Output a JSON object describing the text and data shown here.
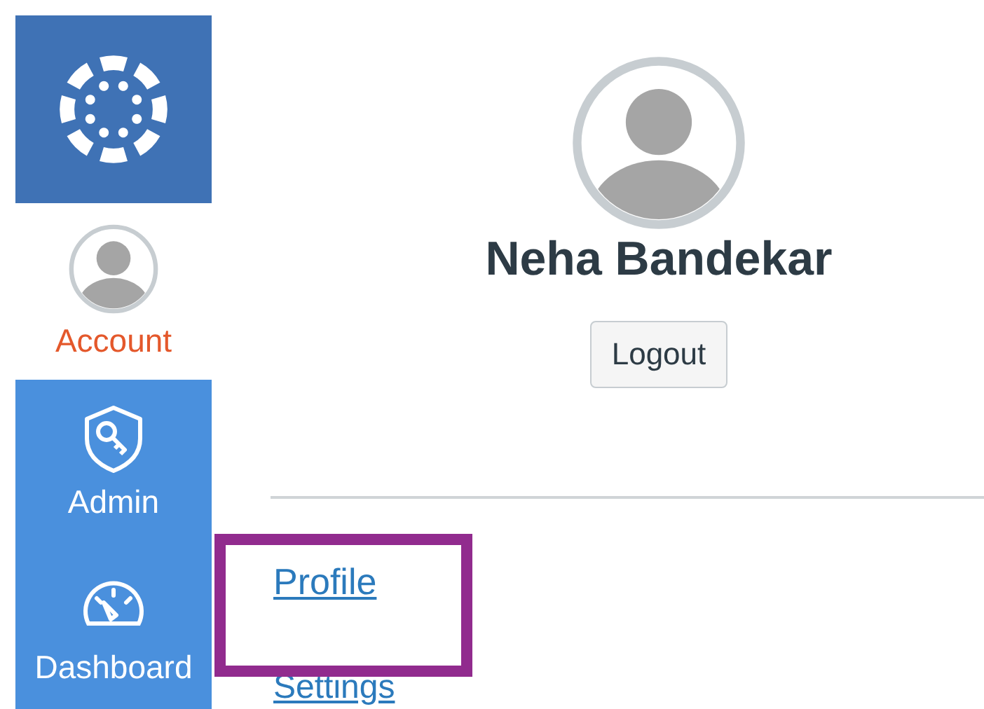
{
  "sidebar": {
    "items": [
      {
        "kind": "account",
        "label": "Account",
        "selected": true
      },
      {
        "kind": "admin",
        "label": "Admin",
        "selected": false
      },
      {
        "kind": "dashboard",
        "label": "Dashboard",
        "selected": false
      }
    ]
  },
  "profile": {
    "name": "Neha Bandekar",
    "logout_button": "Logout"
  },
  "links": [
    {
      "label": "Profile",
      "highlighted": true
    },
    {
      "label": "Settings",
      "highlighted": false
    }
  ]
}
